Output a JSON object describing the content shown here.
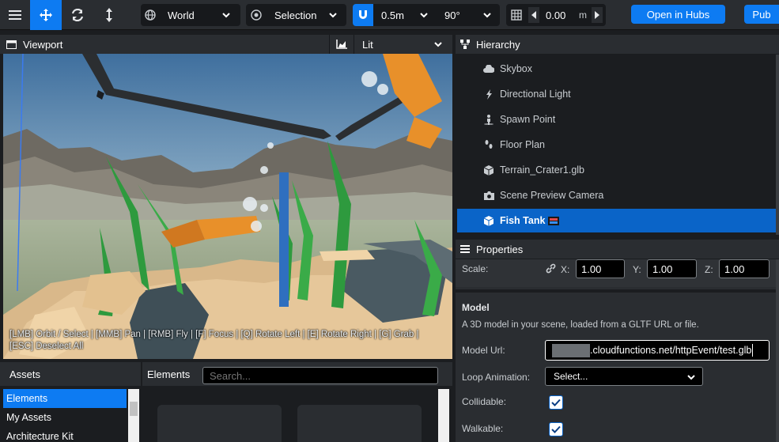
{
  "toolbar": {
    "transform_space": "World",
    "pivot_mode": "Selection",
    "translation_snap": "0.5m",
    "rotation_snap": "90°",
    "grid_height": "0.00",
    "grid_unit": "m",
    "open_in_hubs": "Open in Hubs",
    "publish": "Pub"
  },
  "viewport": {
    "title": "Viewport",
    "render_mode": "Lit",
    "hint_line1": "[LMB] Orbit / Select | [MMB] Pan | [RMB] Fly | [F] Focus | [Q] Rotate Left | [E] Rotate Right | [G] Grab |",
    "hint_line2": "[ESC] Deselect All"
  },
  "hierarchy": {
    "title": "Hierarchy",
    "items": [
      {
        "label": "Skybox",
        "icon": "cloud-icon"
      },
      {
        "label": "Directional Light",
        "icon": "bolt-icon"
      },
      {
        "label": "Spawn Point",
        "icon": "person-icon"
      },
      {
        "label": "Floor Plan",
        "icon": "shoe-prints-icon"
      },
      {
        "label": "Terrain_Crater1.glb",
        "icon": "cube-icon"
      },
      {
        "label": "Scene Preview Camera",
        "icon": "camera-icon"
      },
      {
        "label": "Fish Tank",
        "icon": "cube-icon",
        "selected": true
      }
    ]
  },
  "properties": {
    "title": "Properties",
    "scale_label": "Scale:",
    "x_label": "X:",
    "y_label": "Y:",
    "z_label": "Z:",
    "scale_x": "1.00",
    "scale_y": "1.00",
    "scale_z": "1.00",
    "section_title": "Model",
    "section_desc": "A 3D model in your scene, loaded from a GLTF URL or file.",
    "model_url_label": "Model Url:",
    "model_url_value": ".cloudfunctions.net/httpEvent/test.glb",
    "loop_animation_label": "Loop Animation:",
    "loop_animation_value": "Select...",
    "collidable_label": "Collidable:",
    "walkable_label": "Walkable:"
  },
  "assets": {
    "title": "Assets",
    "sources": [
      "Elements",
      "My Assets",
      "Architecture Kit"
    ],
    "active_source": "Elements",
    "panel_title": "Elements",
    "search_placeholder": "Search..."
  },
  "colors": {
    "accent": "#0a64c8",
    "button_blue": "#0d7bf2",
    "panel_bg": "#2a2d31",
    "dark_bg": "#1b1d20"
  }
}
